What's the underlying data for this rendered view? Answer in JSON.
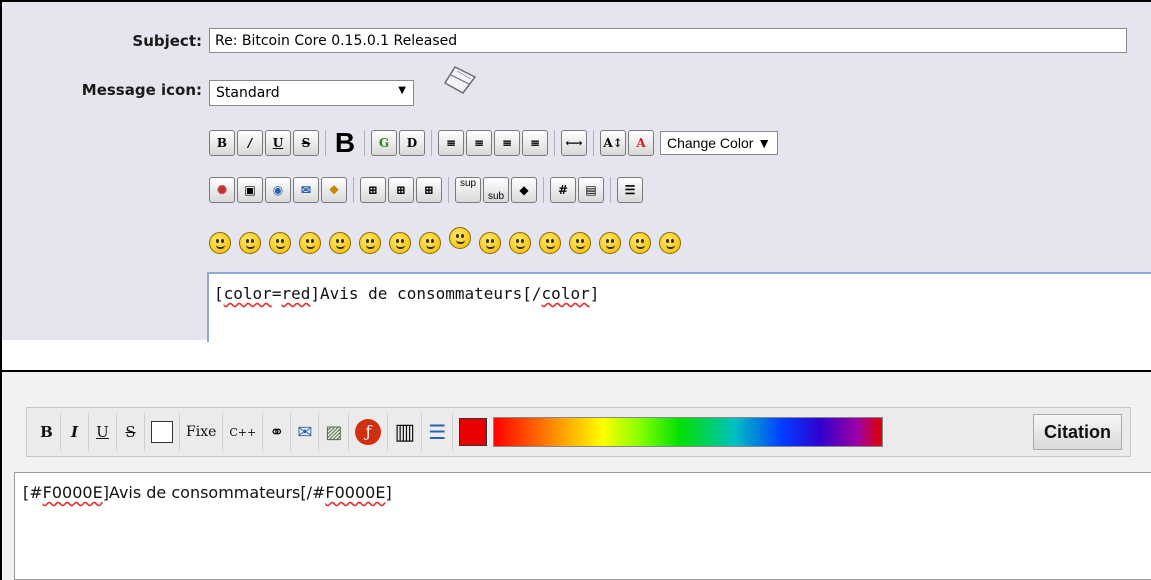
{
  "form": {
    "subject_label": "Subject:",
    "subject_value": "Re: Bitcoin Core 0.15.0.1 Released",
    "message_icon_label": "Message icon:",
    "message_icon_value": "Standard"
  },
  "toolbar1": {
    "row1": [
      "B",
      "I",
      "U",
      "S",
      "bitcoin",
      "G",
      "D",
      "left",
      "justify",
      "center",
      "right",
      "hr",
      "A-size",
      "A-color"
    ],
    "change_color_label": "Change Color ▼",
    "row2_labels": [
      "sup",
      "sub",
      "#"
    ],
    "smiley_count": 16
  },
  "editor1": {
    "content_prefix": "[",
    "content_tag1": "color",
    "content_eq": "=",
    "content_val": "red",
    "content_mid": "]Avis de consommateurs[/",
    "content_tag2": "color",
    "content_suffix": "]"
  },
  "toolbar2": {
    "buttons": [
      "B",
      "I",
      "U",
      "S",
      "Fixe",
      "C++"
    ],
    "swatch_color": "#e80000",
    "citation_label": "Citation"
  },
  "editor2": {
    "prefix": "[#",
    "tag1": "F0000E",
    "mid": "]Avis de consommateurs[/#",
    "tag2": "F0000E",
    "suffix": "]"
  }
}
